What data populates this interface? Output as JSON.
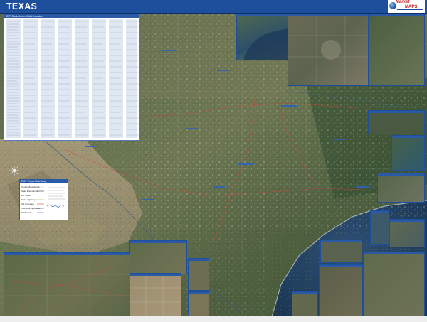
{
  "header": {
    "title": "TEXAS"
  },
  "logo": {
    "line1": "Market",
    "line2": "MAPS"
  },
  "zip_panel": {
    "title": "ZIP Code Index/Grid Locator"
  },
  "legend": {
    "title": "2017 Texas State Map",
    "items": [
      "County Boundaries",
      "State Boundaries",
      "ZIP Code",
      "State Highways",
      "US Highways",
      "Interstate Highways",
      "Toll Roads"
    ]
  },
  "colors": {
    "header": "#1d4f9c",
    "inset_border": "#1d4f9c",
    "logo_red": "#c71f1f"
  }
}
